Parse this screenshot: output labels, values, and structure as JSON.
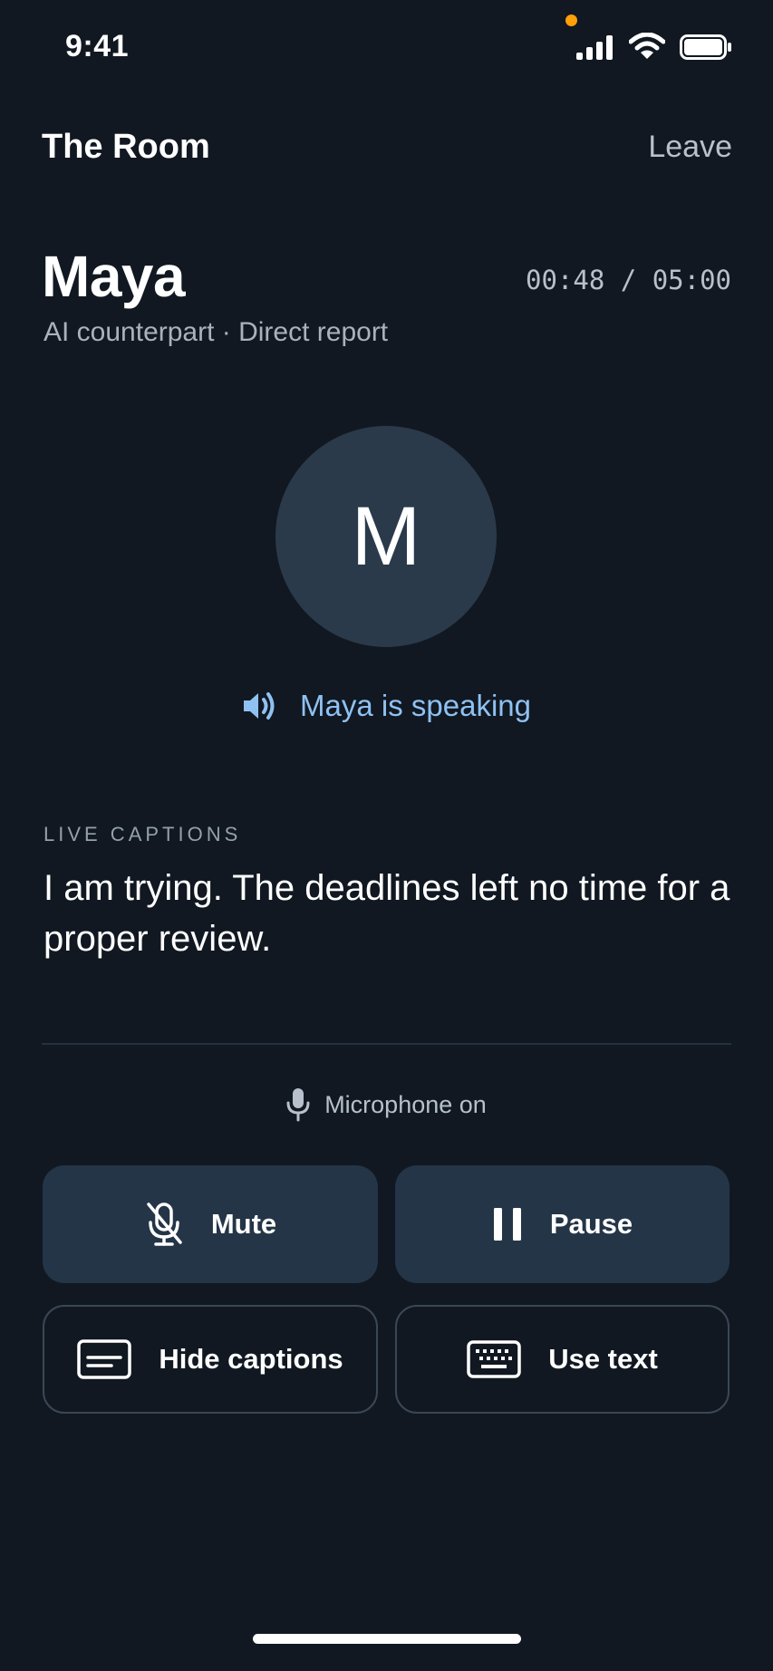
{
  "status_bar": {
    "time": "9:41"
  },
  "header": {
    "title": "The Room",
    "leave_label": "Leave"
  },
  "participant": {
    "name": "Maya",
    "role": "AI counterpart · Direct report",
    "initial": "M"
  },
  "session": {
    "timer": "00:48 / 05:00"
  },
  "speaking": {
    "label": "Maya is speaking",
    "color": "#8fc1f2"
  },
  "captions": {
    "heading": "LIVE CAPTIONS",
    "text": "I am trying. The deadlines left no time for a proper review."
  },
  "microphone": {
    "status": "Microphone on"
  },
  "controls": {
    "mute_label": "Mute",
    "pause_label": "Pause",
    "hide_captions_label": "Hide captions",
    "use_text_label": "Use text"
  },
  "icons": [
    "signal-icon",
    "wifi-icon",
    "battery-icon",
    "speaker-icon",
    "microphone-icon",
    "mic-off-icon",
    "pause-icon",
    "captions-icon",
    "keyboard-icon"
  ],
  "colors": {
    "background": "#111821",
    "surface": "#243547",
    "accent": "#8fc1f2",
    "privacy_indicator": "#ff9f0a"
  }
}
